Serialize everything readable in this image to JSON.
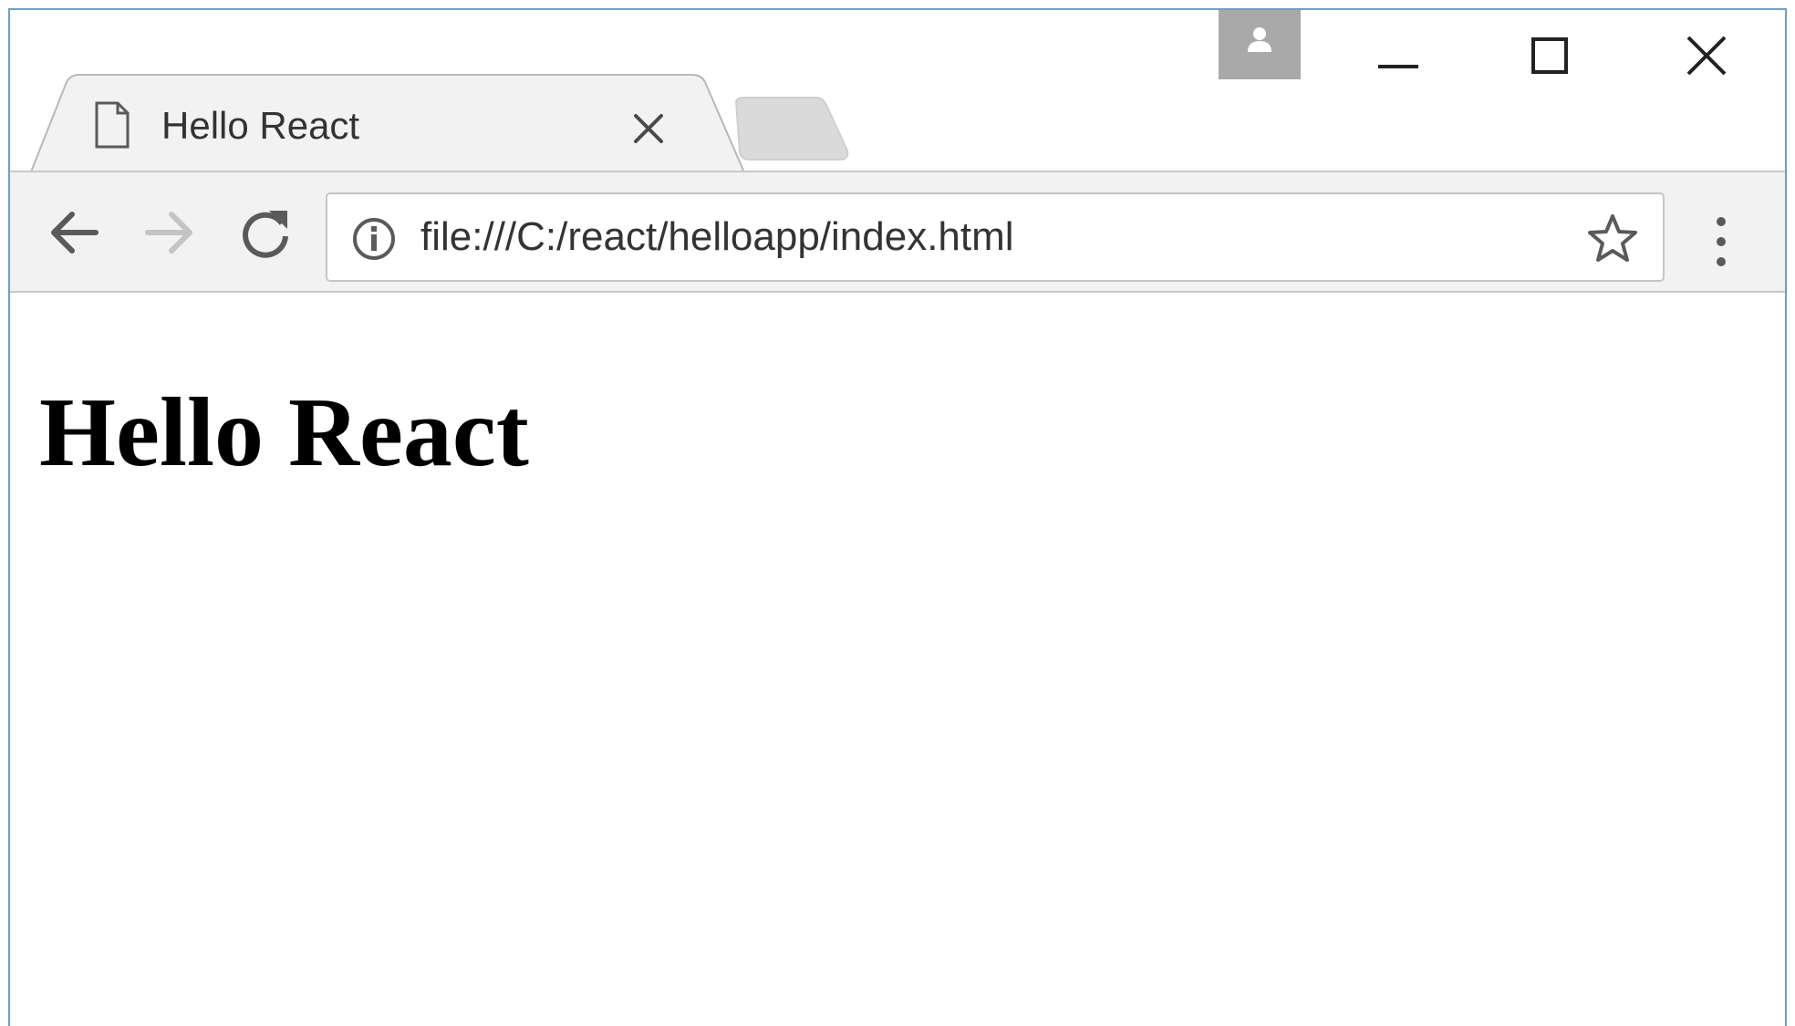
{
  "tab": {
    "title": "Hello React"
  },
  "toolbar": {
    "url": "file:///C:/react/helloapp/index.html"
  },
  "page": {
    "heading": "Hello React"
  },
  "icons": {
    "tab_page": "page-icon",
    "tab_close": "close-icon",
    "profile": "profile-icon",
    "minimize": "minimize-icon",
    "maximize": "maximize-icon",
    "close_window": "close-icon",
    "back": "arrow-left-icon",
    "forward": "arrow-right-icon",
    "reload": "reload-icon",
    "site_info": "info-icon",
    "bookmark": "star-icon",
    "menu": "more-vertical-icon"
  },
  "colors": {
    "window_border": "#6f9ec9",
    "toolbar_bg": "#f2f2f2",
    "active_tab_bg": "#f2f2f2",
    "profile_bg": "#a9a9a9"
  }
}
